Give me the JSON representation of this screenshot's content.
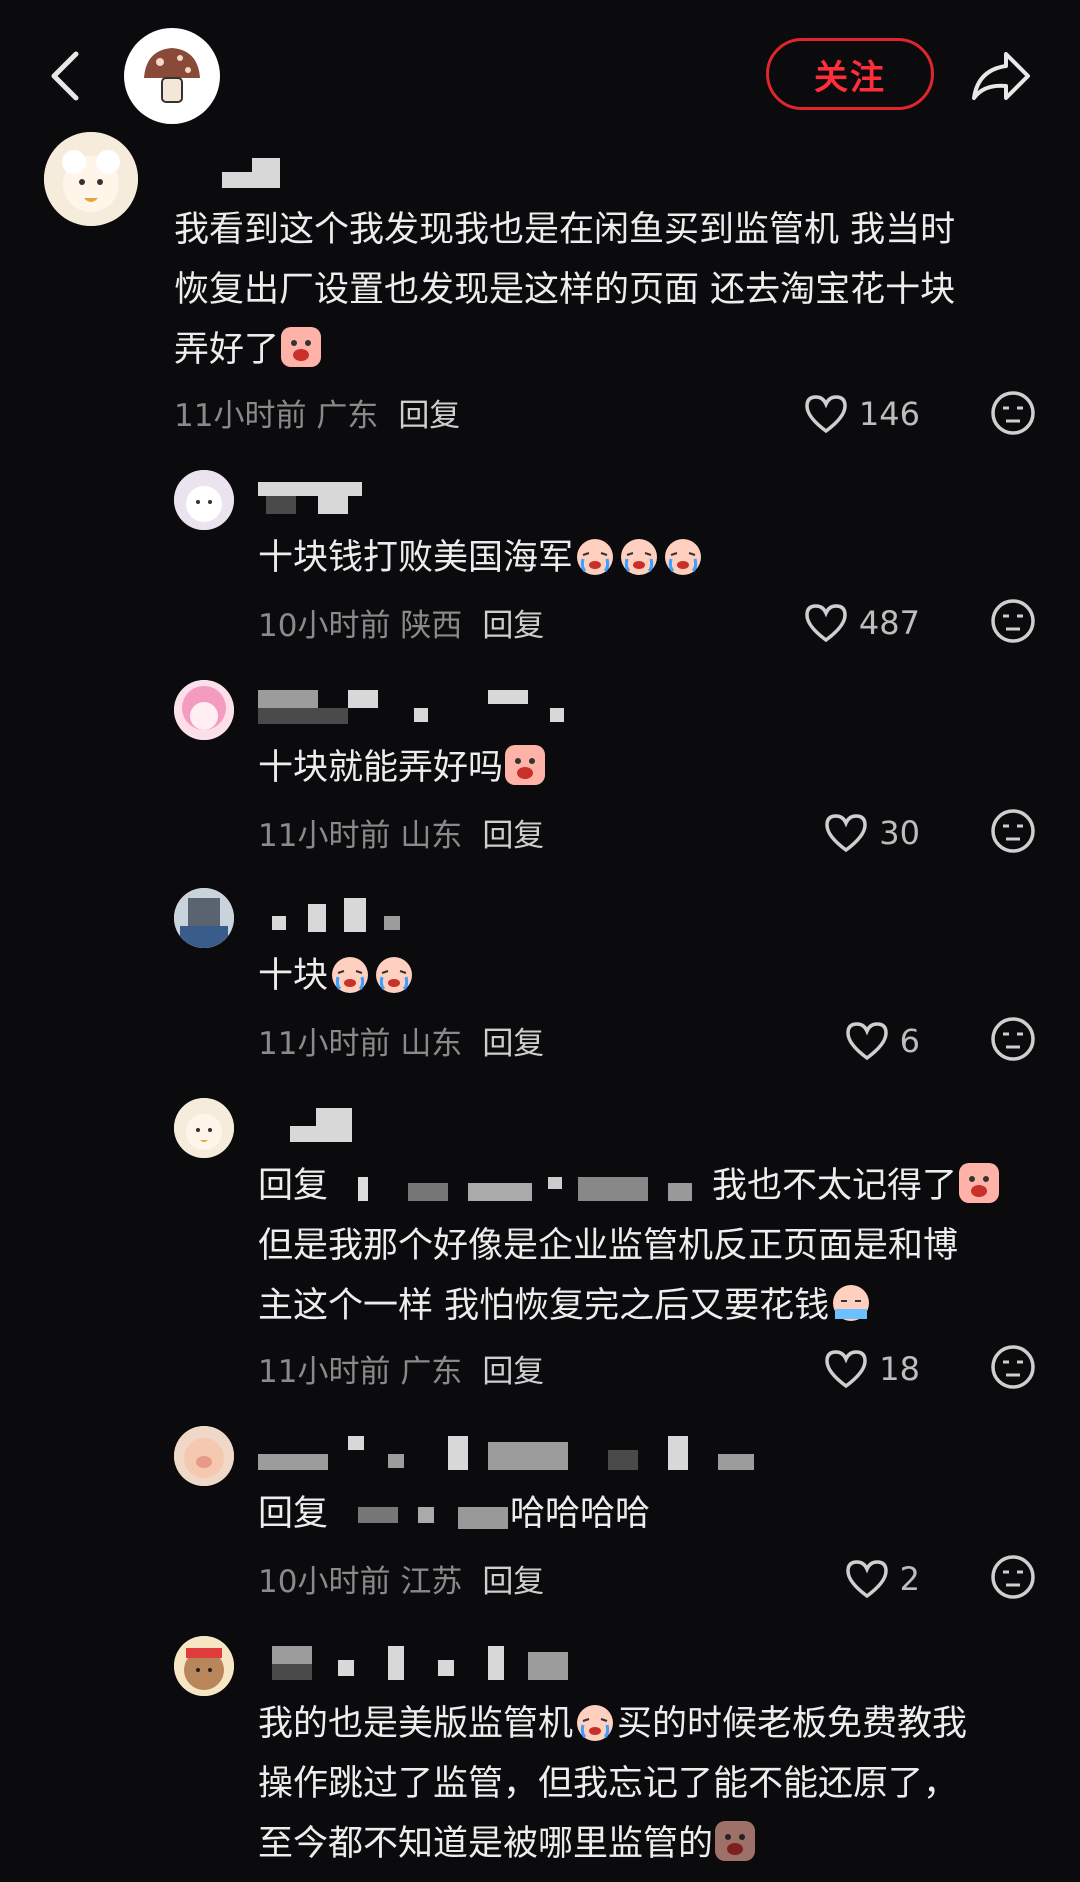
{
  "header": {
    "follow_label": "关注"
  },
  "comments": [
    {
      "text_lines": [
        "我看到这个我发现我也是在闲鱼买到监管机 我当时",
        "恢复出厂设置也发现是这样的页面 还去淘宝花十块",
        "弄好了"
      ],
      "time": "11小时前",
      "location": "广东",
      "reply_label": "回复",
      "likes": "146"
    },
    {
      "text_lines": [
        "十块钱打败美国海军"
      ],
      "time": "10小时前",
      "location": "陕西",
      "reply_label": "回复",
      "likes": "487"
    },
    {
      "text_lines": [
        "十块就能弄好吗"
      ],
      "time": "11小时前",
      "location": "山东",
      "reply_label": "回复",
      "likes": "30"
    },
    {
      "text_lines": [
        "十块"
      ],
      "time": "11小时前",
      "location": "山东",
      "reply_label": "回复",
      "likes": "6"
    },
    {
      "reply_prefix": "回复",
      "text_lines": [
        "我也不太记得了",
        "但是我那个好像是企业监管机反正页面是和博",
        "主这个一样 我怕恢复完之后又要花钱"
      ],
      "time": "11小时前",
      "location": "广东",
      "reply_label": "回复",
      "likes": "18"
    },
    {
      "reply_prefix": "回复",
      "text_lines": [
        "哈哈哈哈"
      ],
      "time": "10小时前",
      "location": "江苏",
      "reply_label": "回复",
      "likes": "2"
    },
    {
      "text_lines": [
        "我的也是美版监管机",
        "买的时候老板免费教我",
        "操作跳过了监管，但我忘记了能不能还原了，",
        "至今都不知道是被哪里监管的"
      ]
    }
  ]
}
